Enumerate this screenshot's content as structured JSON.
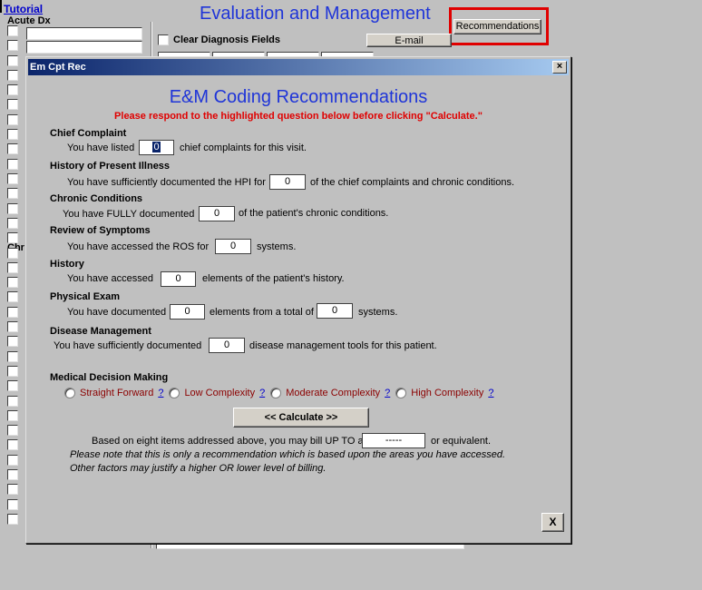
{
  "background": {
    "tutorial_link": "Tutorial",
    "acute_dx_label": "Acute Dx",
    "chronic_label": "Chr",
    "main_title": "Evaluation and Management",
    "recommendations_button": "Recommendations",
    "clear_diagnosis_label": "Clear Diagnosis Fields",
    "email_button": "E-mail"
  },
  "dialog": {
    "window_title": "Em Cpt Rec",
    "close_glyph": "×",
    "heading": "E&M Coding Recommendations",
    "instruction": "Please respond to the highlighted question below before clicking \"Calculate.\"",
    "sections": {
      "chief_complaint": {
        "header": "Chief Complaint",
        "before": "You have listed",
        "value": "0",
        "after": "chief complaints for this visit."
      },
      "hpi": {
        "header": "History of Present Illness",
        "before": "You have sufficiently documented the HPI for",
        "value": "0",
        "after": "of the chief complaints and chronic conditions."
      },
      "chronic": {
        "header": "Chronic Conditions",
        "before": "You have FULLY documented",
        "value": "0",
        "after": "of the patient's chronic conditions."
      },
      "ros": {
        "header": "Review of Symptoms",
        "before": "You have accessed the ROS for",
        "value": "0",
        "after": "systems."
      },
      "history": {
        "header": "History",
        "before": "You have accessed",
        "value": "0",
        "after": "elements of the patient's history."
      },
      "exam": {
        "header": "Physical Exam",
        "before": "You have documented",
        "value": "0",
        "middle": "elements from a total of",
        "value2": "0",
        "after": "systems."
      },
      "disease": {
        "header": "Disease Management",
        "before": "You have sufficiently documented",
        "value": "0",
        "after": "disease management tools for this patient."
      }
    },
    "mdm": {
      "header": "Medical Decision Making",
      "help_glyph": "?",
      "options": [
        "Straight Forward",
        "Low Complexity",
        "Moderate Complexity",
        "High Complexity"
      ]
    },
    "calculate_button": "<<  Calculate >>",
    "bill_before": "Based on eight items addressed above, you may bill UP TO a",
    "bill_value": "-----",
    "bill_after": "or equivalent.",
    "note_line1": "Please note that this is only a recommendation which is based upon the areas you have accessed.",
    "note_line2": "Other factors may justify a higher OR lower level of billing.",
    "x_button": "X"
  }
}
